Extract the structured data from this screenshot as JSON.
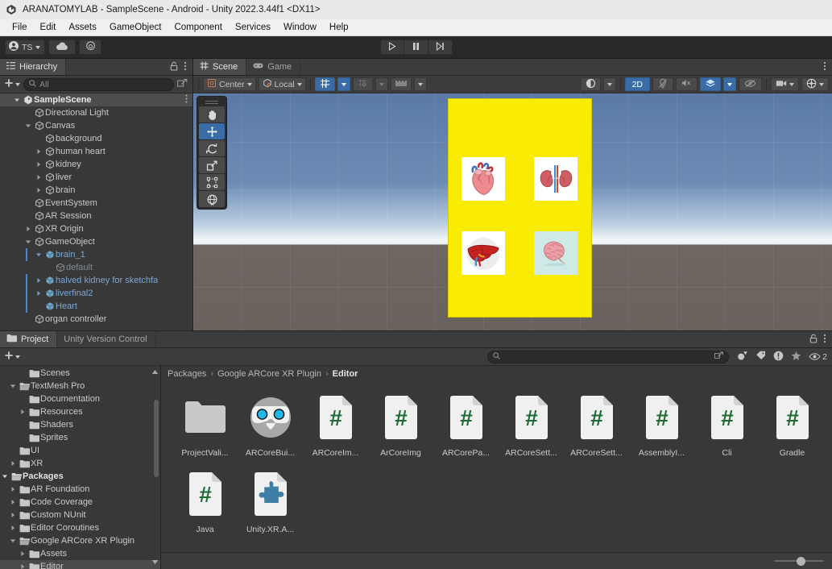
{
  "window": {
    "title": "ARANATOMYLAB - SampleScene - Android - Unity 2022.3.44f1 <DX11>",
    "logo_icon": "unity-logo-icon"
  },
  "menubar": {
    "items": [
      {
        "label": "File"
      },
      {
        "label": "Edit"
      },
      {
        "label": "Assets"
      },
      {
        "label": "GameObject"
      },
      {
        "label": "Component"
      },
      {
        "label": "Services"
      },
      {
        "label": "Window"
      },
      {
        "label": "Help"
      }
    ]
  },
  "toolbar": {
    "account_label": "TS",
    "account_icon": "person-icon",
    "account_caret_icon": "chevron-down-icon",
    "cloud_icon": "cloud-icon",
    "settings_icon": "gear-icon",
    "play_icon": "play-icon",
    "pause_icon": "pause-icon",
    "step_icon": "step-forward-icon"
  },
  "hierarchy": {
    "tab_label": "Hierarchy",
    "tab_icon": "hierarchy-icon",
    "lock_icon": "lock-icon",
    "menu_icon": "kebab-menu-icon",
    "add_icon": "plus-icon",
    "add_caret_icon": "chevron-down-icon",
    "search_icon": "search-icon",
    "search_placeholder": "All",
    "search_value": "",
    "expand_icon": "expand-window-icon",
    "items": [
      {
        "label": "SampleScene",
        "depth": 0,
        "icon": "unity-scene-icon",
        "expanded": true,
        "kind": "scene"
      },
      {
        "label": "Directional Light",
        "depth": 2,
        "icon": "gameobject-icon",
        "kind": "normal"
      },
      {
        "label": "Canvas",
        "depth": 2,
        "icon": "gameobject-icon",
        "expanded": true,
        "kind": "normal"
      },
      {
        "label": "background",
        "depth": 3,
        "icon": "gameobject-icon",
        "kind": "normal"
      },
      {
        "label": "human heart",
        "depth": 3,
        "icon": "gameobject-icon",
        "collapsed": true,
        "kind": "normal"
      },
      {
        "label": "kidney",
        "depth": 3,
        "icon": "gameobject-icon",
        "collapsed": true,
        "kind": "normal"
      },
      {
        "label": "liver",
        "depth": 3,
        "icon": "gameobject-icon",
        "collapsed": true,
        "kind": "normal"
      },
      {
        "label": "brain",
        "depth": 3,
        "icon": "gameobject-icon",
        "collapsed": true,
        "kind": "normal"
      },
      {
        "label": "EventSystem",
        "depth": 2,
        "icon": "gameobject-icon",
        "kind": "normal"
      },
      {
        "label": "AR Session",
        "depth": 2,
        "icon": "gameobject-icon",
        "kind": "normal"
      },
      {
        "label": "XR Origin",
        "depth": 2,
        "icon": "gameobject-icon",
        "collapsed": true,
        "kind": "normal"
      },
      {
        "label": "GameObject",
        "depth": 2,
        "icon": "gameobject-icon",
        "expanded": true,
        "kind": "normal"
      },
      {
        "label": "brain_1",
        "depth": 3,
        "icon": "prefab-icon",
        "expanded": true,
        "kind": "prefab"
      },
      {
        "label": "default",
        "depth": 4,
        "icon": "gameobject-icon",
        "kind": "prefab-child"
      },
      {
        "label": "halved kidney for sketchfa",
        "depth": 3,
        "icon": "prefab-icon",
        "collapsed": true,
        "kind": "prefab"
      },
      {
        "label": "liverfinal2",
        "depth": 3,
        "icon": "prefab-icon",
        "collapsed": true,
        "kind": "prefab"
      },
      {
        "label": "Heart",
        "depth": 3,
        "icon": "prefab-icon",
        "kind": "prefab"
      },
      {
        "label": "organ controller",
        "depth": 2,
        "icon": "gameobject-icon",
        "kind": "normal"
      }
    ]
  },
  "scene": {
    "tabs": [
      {
        "label": "Scene",
        "icon": "scene-grid-icon",
        "active": true
      },
      {
        "label": "Game",
        "icon": "gamepad-icon",
        "active": false
      }
    ],
    "menu_icon": "kebab-menu-icon",
    "toolbar": {
      "pivot_label": "Center",
      "pivot_icon": "pivot-center-icon",
      "pivot_caret_icon": "chevron-down-icon",
      "handle_label": "Local",
      "handle_icon": "handle-local-icon",
      "handle_caret_icon": "chevron-down-icon",
      "grid_snap_icon": "grid-snap-icon",
      "grid_snap_caret_icon": "chevron-down-icon",
      "snap_increment_icon": "snap-increment-icon",
      "snap_increment_caret_icon": "chevron-down-icon",
      "grid_size_icon": "grid-ruler-icon",
      "grid_size_caret_icon": "chevron-down-icon",
      "shading_icon": "shading-mode-icon",
      "shading_caret_icon": "chevron-down-icon",
      "mode_2d_label": "2D",
      "lighting_icon": "lighting-toggle-icon",
      "audio_icon": "audio-mute-icon",
      "effects_icon": "fx-effects-icon",
      "effects_caret_icon": "chevron-down-icon",
      "hidden_objects_icon": "visibility-toggle-icon",
      "camera_icon": "scene-camera-icon",
      "camera_caret_icon": "chevron-down-icon",
      "gizmos_icon": "gizmos-icon",
      "gizmos_caret_icon": "chevron-down-icon"
    },
    "tools": [
      {
        "name": "hand-tool-icon",
        "active": false
      },
      {
        "name": "move-tool-icon",
        "active": true
      },
      {
        "name": "rotate-tool-icon",
        "active": false
      },
      {
        "name": "scale-tool-icon",
        "active": false
      },
      {
        "name": "rect-transform-tool-icon",
        "active": false
      },
      {
        "name": "transform-tool-icon",
        "active": false
      }
    ],
    "canvas_color": "#faec00",
    "organs": [
      {
        "name": "heart-image",
        "label": "human heart"
      },
      {
        "name": "kidney-image",
        "label": "kidney"
      },
      {
        "name": "liver-image",
        "label": "liver"
      },
      {
        "name": "brain-image",
        "label": "brain"
      }
    ]
  },
  "project": {
    "tabs": [
      {
        "label": "Project",
        "icon": "folder-icon",
        "active": true
      },
      {
        "label": "Unity Version Control",
        "icon": "",
        "active": false
      }
    ],
    "lock_icon": "lock-icon",
    "menu_icon": "kebab-menu-icon",
    "add_icon": "plus-icon",
    "add_caret_icon": "chevron-down-icon",
    "search_icon": "search-icon",
    "search_placeholder": "",
    "search_value": "",
    "expand_icon": "expand-window-icon",
    "filters": [
      {
        "name": "asset-type-filter-icon",
        "label": ""
      },
      {
        "name": "label-filter-icon",
        "label": ""
      },
      {
        "name": "warning-filter-icon",
        "label": ""
      },
      {
        "name": "favorite-star-icon",
        "label": ""
      },
      {
        "name": "visibility-eye-icon",
        "label": "2"
      }
    ],
    "breadcrumb": [
      "Packages",
      "Google ARCore XR Plugin",
      "Editor"
    ],
    "tree": [
      {
        "label": "Scenes",
        "depth": 2,
        "arrow": "none",
        "icon": "folder-icon"
      },
      {
        "label": "TextMesh Pro",
        "depth": 1,
        "arrow": "expanded",
        "icon": "folder-open-icon"
      },
      {
        "label": "Documentation",
        "depth": 2,
        "arrow": "none",
        "icon": "folder-icon"
      },
      {
        "label": "Resources",
        "depth": 2,
        "arrow": "collapsed",
        "icon": "folder-icon"
      },
      {
        "label": "Shaders",
        "depth": 2,
        "arrow": "none",
        "icon": "folder-icon"
      },
      {
        "label": "Sprites",
        "depth": 2,
        "arrow": "none",
        "icon": "folder-icon"
      },
      {
        "label": "UI",
        "depth": 1,
        "arrow": "none",
        "icon": "folder-icon"
      },
      {
        "label": "XR",
        "depth": 1,
        "arrow": "collapsed",
        "icon": "folder-icon"
      },
      {
        "label": "Packages",
        "depth": 0,
        "arrow": "expanded",
        "icon": "folder-open-icon",
        "bold": true
      },
      {
        "label": "AR Foundation",
        "depth": 1,
        "arrow": "collapsed",
        "icon": "folder-icon"
      },
      {
        "label": "Code Coverage",
        "depth": 1,
        "arrow": "collapsed",
        "icon": "folder-icon"
      },
      {
        "label": "Custom NUnit",
        "depth": 1,
        "arrow": "collapsed",
        "icon": "folder-icon"
      },
      {
        "label": "Editor Coroutines",
        "depth": 1,
        "arrow": "collapsed",
        "icon": "folder-icon"
      },
      {
        "label": "Google ARCore XR Plugin",
        "depth": 1,
        "arrow": "expanded",
        "icon": "folder-open-icon"
      },
      {
        "label": "Assets",
        "depth": 2,
        "arrow": "collapsed",
        "icon": "folder-icon"
      },
      {
        "label": "Editor",
        "depth": 2,
        "arrow": "collapsed",
        "icon": "folder-icon",
        "selected": true
      }
    ],
    "assets": [
      {
        "label": "ProjectVali...",
        "icon": "folder-asset-icon"
      },
      {
        "label": "ARCoreBui...",
        "icon": "vr-headset-asset-icon"
      },
      {
        "label": "ARCoreIm...",
        "icon": "csharp-script-icon"
      },
      {
        "label": "ArCoreImg",
        "icon": "csharp-script-icon"
      },
      {
        "label": "ARCorePa...",
        "icon": "csharp-script-icon"
      },
      {
        "label": "ARCoreSett...",
        "icon": "csharp-script-icon"
      },
      {
        "label": "ARCoreSett...",
        "icon": "csharp-script-icon"
      },
      {
        "label": "AssemblyI...",
        "icon": "csharp-script-icon"
      },
      {
        "label": "Cli",
        "icon": "csharp-script-icon"
      },
      {
        "label": "Gradle",
        "icon": "csharp-script-icon"
      },
      {
        "label": "Java",
        "icon": "csharp-script-icon"
      },
      {
        "label": "Unity.XR.A...",
        "icon": "assembly-definition-icon"
      }
    ],
    "zoom_slider_value": 55
  }
}
